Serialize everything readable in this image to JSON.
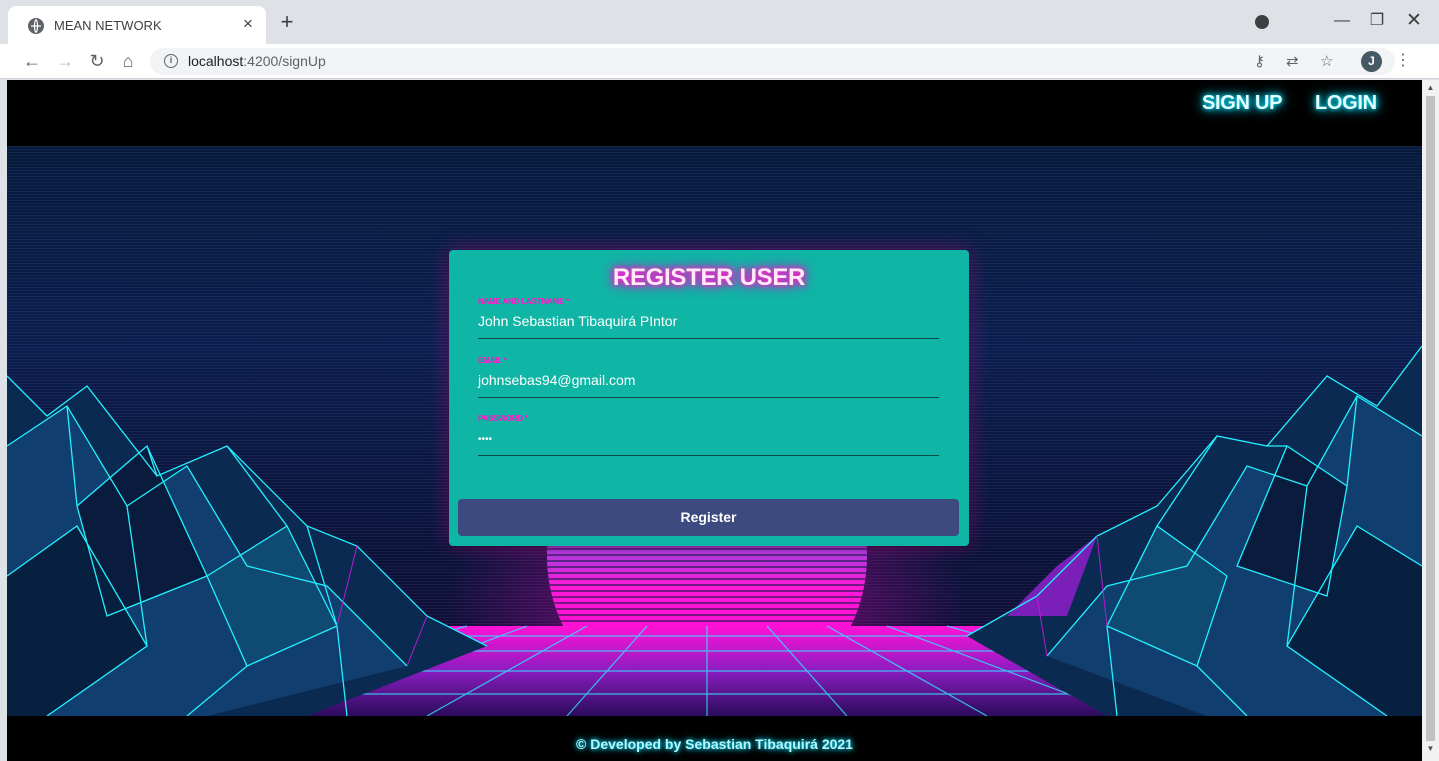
{
  "browser": {
    "tab_title": "MEAN NETWORK",
    "tab_close": "×",
    "new_tab": "+",
    "url_host": "localhost",
    "url_path": ":4200/signUp",
    "avatar_letter": "J",
    "icons": [
      "globe-icon",
      "back-arrow-icon",
      "forward-arrow-icon",
      "reload-icon",
      "home-icon",
      "info-icon",
      "key-icon",
      "translate-icon",
      "star-icon",
      "menu-dots-icon",
      "minimize-icon",
      "restore-icon",
      "close-icon"
    ]
  },
  "navbar": {
    "signup_label": "SIGN UP",
    "login_label": "LOGIN"
  },
  "form": {
    "title": "REGISTER USER",
    "name_label": "NAME AND LASTNAME *",
    "name_value": "John Sebastian Tibaquirá PIntor",
    "email_label": "EMAIL *",
    "email_value": "johnsebas94@gmail.com",
    "password_label": "PASSWORD *",
    "password_value": "••••",
    "submit_label": "Register"
  },
  "footer": {
    "text": "© Developed by Sebastian Tibaquirá 2021"
  },
  "colors": {
    "card": "#0fb5a5",
    "neon_pink": "#ff00c8",
    "neon_cyan": "#00e5ff",
    "button": "#3d4a80"
  }
}
